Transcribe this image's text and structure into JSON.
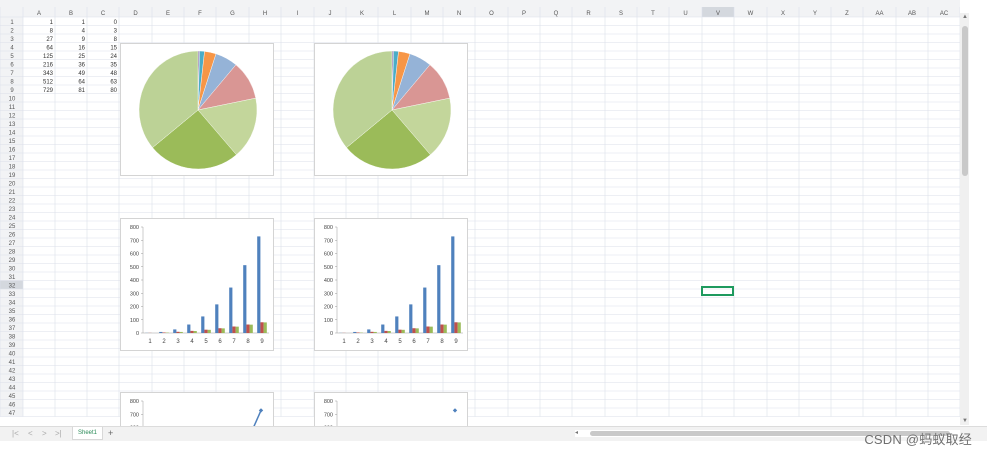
{
  "columns": [
    "A",
    "B",
    "C",
    "D",
    "E",
    "F",
    "G",
    "H",
    "I",
    "J",
    "K",
    "L",
    "M",
    "N",
    "O",
    "P",
    "Q",
    "R",
    "S",
    "T",
    "U",
    "V",
    "W",
    "X",
    "Y",
    "Z",
    "AA",
    "AB",
    "AC"
  ],
  "row_numbers": [
    "1",
    "2",
    "3",
    "4",
    "5",
    "6",
    "7",
    "8",
    "9",
    "10",
    "11",
    "12",
    "13",
    "14",
    "15",
    "16",
    "17",
    "18",
    "19",
    "20",
    "21",
    "22",
    "23",
    "24",
    "25",
    "26",
    "27",
    "28",
    "29",
    "30",
    "31",
    "32",
    "33",
    "34",
    "35",
    "36",
    "37",
    "38",
    "39",
    "40",
    "41",
    "42",
    "43",
    "44",
    "45",
    "46",
    "47"
  ],
  "selected_column": "V",
  "selected_row": "32",
  "cells": [
    [
      "1",
      "1",
      "0"
    ],
    [
      "8",
      "4",
      "3"
    ],
    [
      "27",
      "9",
      "8"
    ],
    [
      "64",
      "16",
      "15"
    ],
    [
      "125",
      "25",
      "24"
    ],
    [
      "216",
      "36",
      "35"
    ],
    [
      "343",
      "49",
      "48"
    ],
    [
      "512",
      "64",
      "63"
    ],
    [
      "729",
      "81",
      "80"
    ]
  ],
  "colors": {
    "series_a": "#4f81bd",
    "series_b": "#c0504d",
    "series_c": "#9bbb59",
    "grid_line": "#dbe0ea",
    "header_bg": "#f2f3f5",
    "accent": "#1e9a5e"
  },
  "chart_data": [
    {
      "type": "pie",
      "values": [
        1,
        8,
        27,
        64,
        125,
        216,
        343,
        512,
        729
      ],
      "colors": [
        "#9bbb59",
        "#8064a2",
        "#4bacc6",
        "#f79646",
        "#95b3d7",
        "#d99694",
        "#c3d69b",
        "#9bbb59",
        "#bcd296"
      ]
    },
    {
      "type": "pie",
      "values": [
        1,
        8,
        27,
        64,
        125,
        216,
        343,
        512,
        729
      ],
      "colors": [
        "#9bbb59",
        "#8064a2",
        "#4bacc6",
        "#f79646",
        "#95b3d7",
        "#d99694",
        "#c3d69b",
        "#9bbb59",
        "#bcd296"
      ]
    },
    {
      "type": "bar",
      "categories": [
        "1",
        "2",
        "3",
        "4",
        "5",
        "6",
        "7",
        "8",
        "9"
      ],
      "series": [
        {
          "values": [
            1,
            8,
            27,
            64,
            125,
            216,
            343,
            512,
            729
          ]
        },
        {
          "values": [
            1,
            4,
            9,
            16,
            25,
            36,
            49,
            64,
            81
          ]
        },
        {
          "values": [
            0,
            3,
            8,
            15,
            24,
            35,
            48,
            63,
            80
          ]
        }
      ],
      "yticks": [
        "0",
        "100",
        "200",
        "300",
        "400",
        "500",
        "600",
        "700",
        "800"
      ],
      "ylim": [
        0,
        800
      ]
    },
    {
      "type": "bar",
      "categories": [
        "1",
        "2",
        "3",
        "4",
        "5",
        "6",
        "7",
        "8",
        "9"
      ],
      "series": [
        {
          "values": [
            1,
            8,
            27,
            64,
            125,
            216,
            343,
            512,
            729
          ]
        },
        {
          "values": [
            1,
            4,
            9,
            16,
            25,
            36,
            49,
            64,
            81
          ]
        },
        {
          "values": [
            0,
            3,
            8,
            15,
            24,
            35,
            48,
            63,
            80
          ]
        }
      ],
      "yticks": [
        "0",
        "100",
        "200",
        "300",
        "400",
        "500",
        "600",
        "700",
        "800"
      ],
      "ylim": [
        0,
        800
      ]
    },
    {
      "type": "line",
      "yticks": [
        "800",
        "700",
        "600"
      ],
      "ylim": [
        0,
        800
      ],
      "visible_point": {
        "x": "9",
        "y": 729
      },
      "connected": true
    },
    {
      "type": "scatter",
      "yticks": [
        "800",
        "700",
        "600"
      ],
      "ylim": [
        0,
        800
      ],
      "visible_point": {
        "x": "9",
        "y": 729
      },
      "connected": false
    }
  ],
  "sheet_tab": "Sheet1",
  "add_sheet_label": "+",
  "nav_arrows": [
    "|<",
    "<",
    ">",
    ">|"
  ],
  "watermark": "CSDN @蚂蚁取经"
}
